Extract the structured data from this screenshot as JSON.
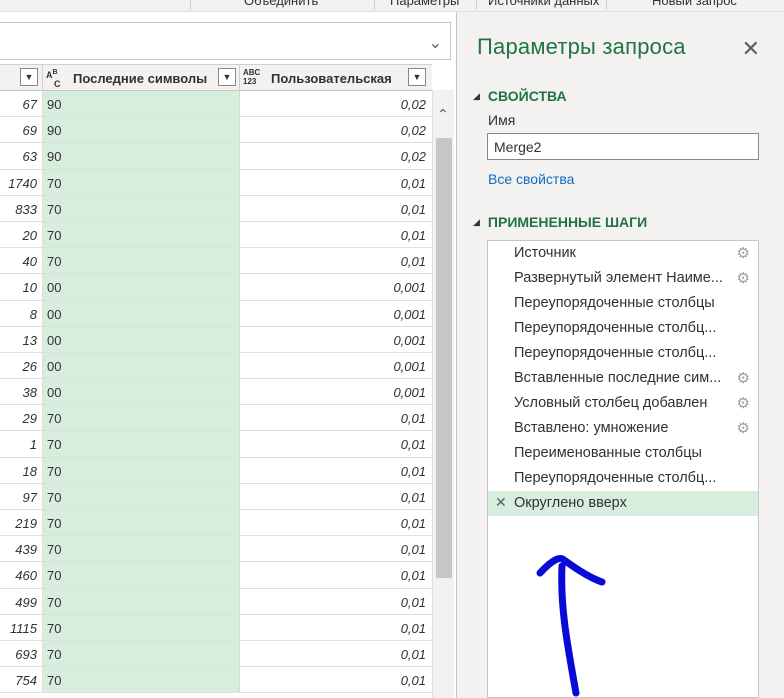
{
  "ribbon": {
    "items": [
      "Объединить",
      "Параметры",
      "Источники данных",
      "Новый запрос"
    ]
  },
  "grid": {
    "columns": [
      {
        "type_icon": "ABC",
        "type_icon_sub": "",
        "label": ""
      },
      {
        "type_icon": "Aᴮ",
        "type_icon_sub": "C",
        "label": "Последние символы"
      },
      {
        "type_icon": "ABC",
        "type_icon_sub": "123",
        "label": "Пользовательская"
      }
    ],
    "rows": [
      [
        "67",
        "90",
        "0,02"
      ],
      [
        "69",
        "90",
        "0,02"
      ],
      [
        "63",
        "90",
        "0,02"
      ],
      [
        "1740",
        "70",
        "0,01"
      ],
      [
        "833",
        "70",
        "0,01"
      ],
      [
        "20",
        "70",
        "0,01"
      ],
      [
        "40",
        "70",
        "0,01"
      ],
      [
        "10",
        "00",
        "0,001"
      ],
      [
        "8",
        "00",
        "0,001"
      ],
      [
        "13",
        "00",
        "0,001"
      ],
      [
        "26",
        "00",
        "0,001"
      ],
      [
        "38",
        "00",
        "0,001"
      ],
      [
        "29",
        "70",
        "0,01"
      ],
      [
        "1",
        "70",
        "0,01"
      ],
      [
        "18",
        "70",
        "0,01"
      ],
      [
        "97",
        "70",
        "0,01"
      ],
      [
        "219",
        "70",
        "0,01"
      ],
      [
        "439",
        "70",
        "0,01"
      ],
      [
        "460",
        "70",
        "0,01"
      ],
      [
        "499",
        "70",
        "0,01"
      ],
      [
        "1115",
        "70",
        "0,01"
      ],
      [
        "693",
        "70",
        "0,01"
      ],
      [
        "754",
        "70",
        "0,01"
      ]
    ]
  },
  "pane": {
    "title": "Параметры запроса",
    "properties_header": "СВОЙСТВА",
    "name_label": "Имя",
    "name_value": "Merge2",
    "all_properties": "Все свойства",
    "steps_header": "ПРИМЕНЕННЫЕ ШАГИ",
    "steps": [
      {
        "label": "Источник",
        "gear": true,
        "active": false
      },
      {
        "label": "Развернутый элемент Наиме...",
        "gear": true,
        "active": false
      },
      {
        "label": "Переупорядоченные столбцы",
        "gear": false,
        "active": false
      },
      {
        "label": "Переупорядоченные столбц...",
        "gear": false,
        "active": false
      },
      {
        "label": "Переупорядоченные столбц...",
        "gear": false,
        "active": false
      },
      {
        "label": "Вставленные последние сим...",
        "gear": true,
        "active": false
      },
      {
        "label": "Условный столбец добавлен",
        "gear": true,
        "active": false
      },
      {
        "label": "Вставлено: умножение",
        "gear": true,
        "active": false
      },
      {
        "label": "Переименованные столбцы",
        "gear": false,
        "active": false
      },
      {
        "label": "Переупорядоченные столбц...",
        "gear": false,
        "active": false
      },
      {
        "label": "Округлено вверх",
        "gear": false,
        "active": true
      }
    ]
  },
  "colors": {
    "accent": "#217346",
    "highlight": "#d7eedf",
    "annotation": "#0a0ad8"
  }
}
